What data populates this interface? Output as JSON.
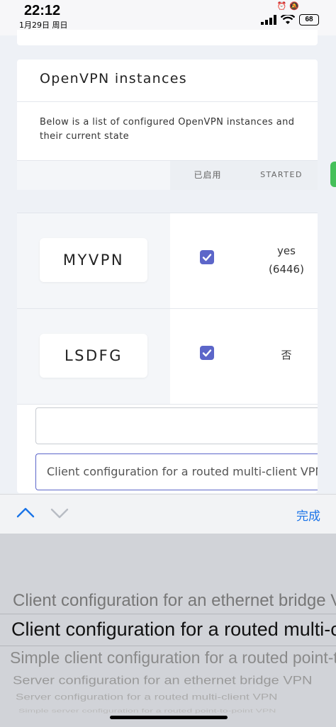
{
  "status_bar": {
    "time": "22:12",
    "date": "1月29日 周日",
    "battery": "68"
  },
  "card": {
    "title": "OpenVPN instances",
    "description": "Below is a list of configured OpenVPN instances and their current state"
  },
  "table": {
    "headers": {
      "enabled": "已启用",
      "started": "STARTED"
    },
    "rows": [
      {
        "name": "MYVPN",
        "enabled": true,
        "started_line1": "yes",
        "started_line2": "(6446)"
      },
      {
        "name": "LSDFG",
        "enabled": true,
        "started_line1": "否",
        "started_line2": ""
      }
    ]
  },
  "form": {
    "empty_input_value": "",
    "template_select_value": "Client configuration for a routed multi-client VPN"
  },
  "toolbar": {
    "done_label": "完成"
  },
  "picker": {
    "options": [
      "Client configuration for an ethernet bridge VPN",
      "Client configuration for a routed multi-client VPN",
      "Simple client configuration for a routed point-to-point VPN",
      "Server configuration for an ethernet bridge VPN",
      "Server configuration for a routed multi-client VPN",
      "Simple server configuration for a routed point-to-point VPN"
    ],
    "selected_index": 1
  },
  "colors": {
    "accent": "#5c66c9",
    "link": "#1a73e8",
    "picker_bg": "#d1d3d8"
  }
}
